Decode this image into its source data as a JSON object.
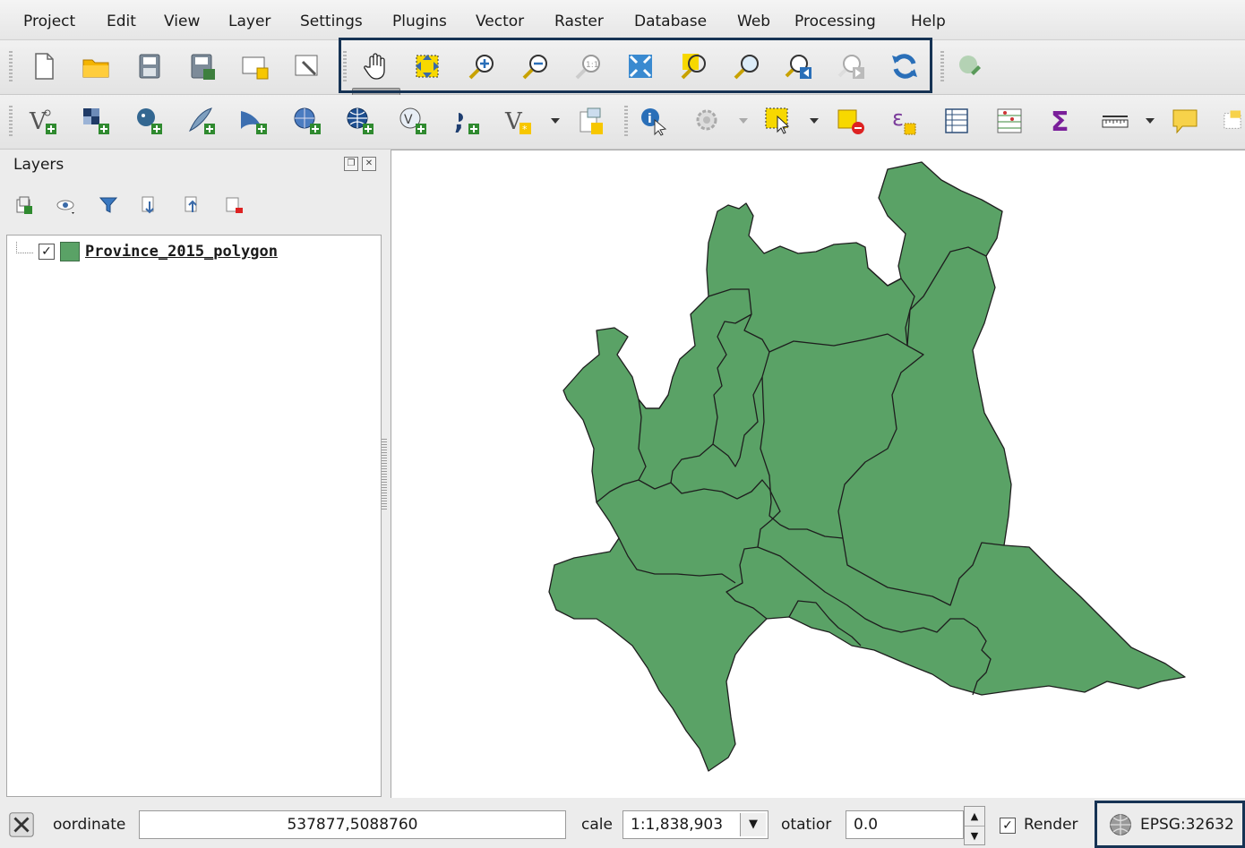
{
  "menu": [
    "Project",
    "Edit",
    "View",
    "Layer",
    "Settings",
    "Plugins",
    "Vector",
    "Raster",
    "Database",
    "Web",
    "Processing",
    "Help"
  ],
  "icons": {
    "file_toolbar": [
      "new-project-icon",
      "open-project-icon",
      "save-project-icon",
      "save-as-icon",
      "new-print-composer-icon",
      "composer-manager-icon"
    ],
    "map_nav_toolbar": [
      "pan-icon",
      "pan-to-selection-icon",
      "zoom-in-icon",
      "zoom-out-icon",
      "zoom-native-icon",
      "zoom-full-icon",
      "zoom-to-selection-icon",
      "zoom-to-layer-icon",
      "zoom-last-icon",
      "zoom-next-icon",
      "refresh-icon",
      "plugin-icon"
    ],
    "layer_toolbar": [
      "add-vector-layer-icon",
      "add-raster-layer-icon",
      "add-postgis-layer-icon",
      "add-spatialite-layer-icon",
      "add-mssql-layer-icon",
      "add-wms-layer-icon",
      "add-wcs-layer-icon",
      "add-wfs-layer-icon",
      "add-delimited-text-icon",
      "new-shapefile-icon",
      "new-temporary-layer-icon"
    ],
    "attributes_toolbar": [
      "identify-icon",
      "action-icon",
      "select-features-icon",
      "deselect-icon",
      "field-calculator-icon",
      "attribute-table-icon",
      "statistics-icon",
      "sum-icon",
      "measure-icon",
      "map-tips-icon",
      "text-annotation-icon"
    ]
  },
  "layers_panel": {
    "title": "Layers",
    "layer": {
      "name": "Province_2015_polygon",
      "checked": true,
      "color": "#5aa266"
    }
  },
  "status": {
    "coordinate_label": "oordinate",
    "coordinate_value": "537877,5088760",
    "scale_label": "cale",
    "scale_value": "1:1,838,903",
    "rotation_label": "otatior",
    "rotation_value": "0.0",
    "render_label": "Render",
    "render_checked": true,
    "crs": "EPSG:32632"
  },
  "colors": {
    "polygon_fill": "#5aa266",
    "polygon_stroke": "#1e1e1e",
    "highlight": "#163354"
  }
}
